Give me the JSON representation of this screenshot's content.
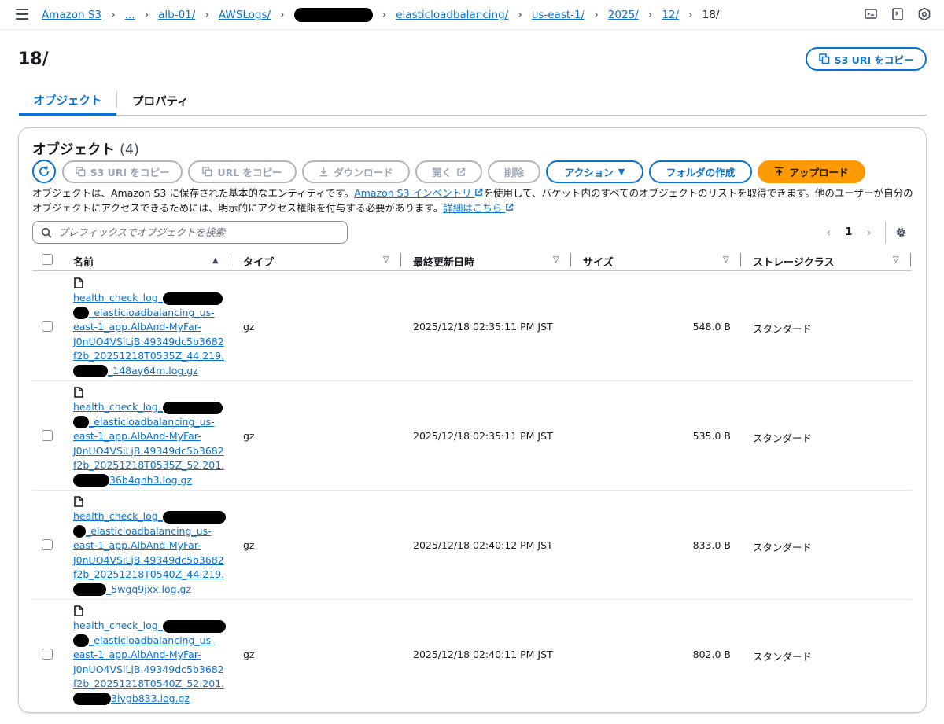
{
  "breadcrumbs": {
    "root": "Amazon S3",
    "ellipsis": "...",
    "bucket": "alb-01/",
    "awslogs": "AWSLogs/",
    "service": "elasticloadbalancing/",
    "region": "us-east-1/",
    "year": "2025/",
    "month": "12/",
    "current": "18/"
  },
  "header": {
    "title": "18/",
    "copy_uri_label": "S3 URI をコピー"
  },
  "tabs": [
    {
      "label": "オブジェクト",
      "active": true
    },
    {
      "label": "プロパティ",
      "active": false
    }
  ],
  "panel": {
    "title": "オブジェクト",
    "count": "(4)",
    "toolbar": {
      "copy_s3_uri": "S3 URI をコピー",
      "copy_url": "URL をコピー",
      "download": "ダウンロード",
      "open": "開く",
      "delete": "削除",
      "actions": "アクション",
      "create_folder": "フォルダの作成",
      "upload": "アップロード"
    },
    "description": {
      "part1": "オブジェクトは、Amazon S3 に保存された基本的なエンティティです。",
      "inventory_link": "Amazon S3 インベントリ",
      "part2": "を使用して、バケット内のすべてのオブジェクトのリストを取得できます。他のユーザーが自分のオブジェクトにアクセスできるためには、明示的にアクセス権限を付与する必要があります。",
      "more_link": "詳細はこちら"
    },
    "search": {
      "placeholder": "プレフィックスでオブジェクトを検索",
      "value": ""
    },
    "pagination": {
      "current_page": "1"
    }
  },
  "table": {
    "columns": {
      "name": "名前",
      "type": "タイプ",
      "modified": "最終更新日時",
      "size": "サイズ",
      "storage": "ストレージクラス"
    },
    "rows": [
      {
        "name_lines": [
          "health_check_log_",
          "_elasticloadbalancing_us-",
          "east-1_app.AlbAnd-MyFar-",
          "J0nUO4VSiLjB.49349dc5b3682",
          "f2b_20251218T0535Z_44.219.",
          "_148ay64m.log.gz"
        ],
        "type": "gz",
        "modified": "2025/12/18 02:35:11 PM JST",
        "size": "548.0 B",
        "storage": "スタンダード"
      },
      {
        "name_lines": [
          "health_check_log_",
          "_elasticloadbalancing_us-",
          "east-1_app.AlbAnd-MyFar-",
          "J0nUO4VSiLjB.49349dc5b3682",
          "f2b_20251218T0535Z_52.201.",
          "36b4qnh3.log.gz"
        ],
        "type": "gz",
        "modified": "2025/12/18 02:35:11 PM JST",
        "size": "535.0 B",
        "storage": "スタンダード"
      },
      {
        "name_lines": [
          "health_check_log_",
          "_elasticloadbalancing_us-",
          "east-1_app.AlbAnd-MyFar-",
          "J0nUO4VSiLjB.49349dc5b3682",
          "f2b_20251218T0540Z_44.219.",
          "_5wgq9jxx.log.gz"
        ],
        "type": "gz",
        "modified": "2025/12/18 02:40:12 PM JST",
        "size": "833.0 B",
        "storage": "スタンダード"
      },
      {
        "name_lines": [
          "health_check_log_",
          "_elasticloadbalancing_us-",
          "east-1_app.AlbAnd-MyFar-",
          "J0nUO4VSiLjB.49349dc5b3682",
          "f2b_20251218T0540Z_52.201.",
          "3iygb833.log.gz"
        ],
        "type": "gz",
        "modified": "2025/12/18 02:40:11 PM JST",
        "size": "802.0 B",
        "storage": "スタンダード"
      }
    ]
  },
  "colors": {
    "link": "#0972d3",
    "upload": "#ff9900",
    "disabled": "#9ba7b6"
  }
}
